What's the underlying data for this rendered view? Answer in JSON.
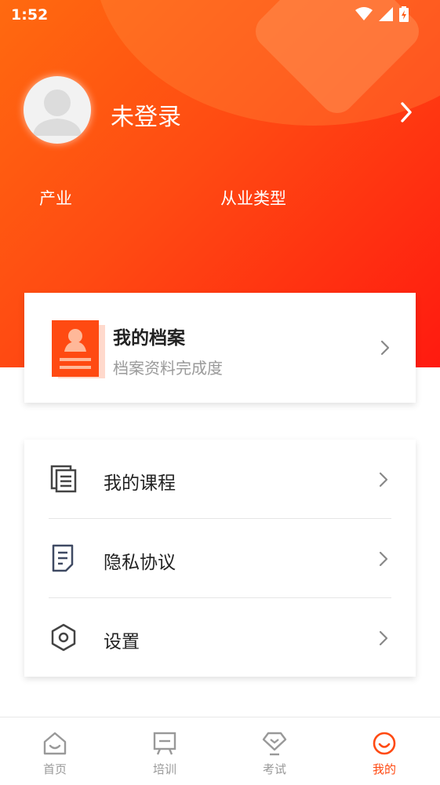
{
  "status_bar": {
    "time": "1:52"
  },
  "profile": {
    "name": "未登录"
  },
  "meta": {
    "industry_label": "产业",
    "type_label": "从业类型"
  },
  "archive": {
    "title": "我的档案",
    "subtitle": "档案资料完成度"
  },
  "menu": {
    "items": [
      {
        "label": "我的课程",
        "icon": "courses-icon"
      },
      {
        "label": "隐私协议",
        "icon": "document-icon"
      },
      {
        "label": "设置",
        "icon": "settings-hexagon-icon"
      }
    ]
  },
  "tabbar": {
    "tabs": [
      {
        "label": "首页",
        "icon": "home-icon"
      },
      {
        "label": "培训",
        "icon": "training-icon"
      },
      {
        "label": "考试",
        "icon": "exam-icon"
      },
      {
        "label": "我的",
        "icon": "profile-icon",
        "active": true
      }
    ]
  },
  "colors": {
    "accent": "#ff4a12",
    "hero_start": "#ff6a10",
    "hero_end": "#ff1a10"
  }
}
